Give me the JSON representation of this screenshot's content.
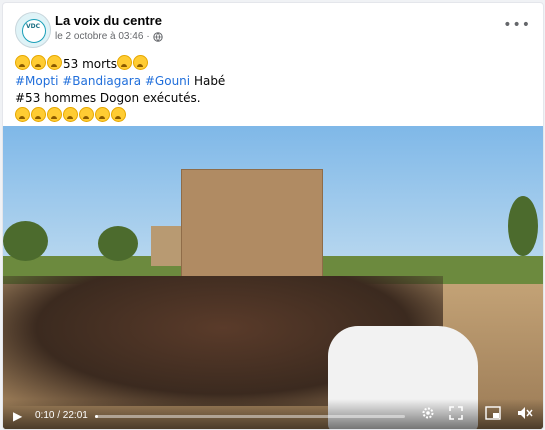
{
  "post": {
    "page_name": "La voix du centre",
    "date": "le 2 octobre à 03:46",
    "more_label": "•••",
    "line1_text": "53 morts",
    "tags": [
      "#Mopti",
      "#Bandiagara",
      "#Gouni"
    ],
    "line2_tail": " Habé",
    "line3": "#53 hommes Dogon exécutés.",
    "avatar_text": "VDC"
  },
  "video": {
    "time": "0:10 / 22:01",
    "progress": 0.0076
  },
  "icons": {
    "globe": "globe-icon",
    "more": "more-options-icon",
    "play": "play-icon",
    "settings": "gear-icon",
    "fullscreen": "fullscreen-icon",
    "pip": "picture-in-picture-icon",
    "volume": "volume-icon"
  }
}
